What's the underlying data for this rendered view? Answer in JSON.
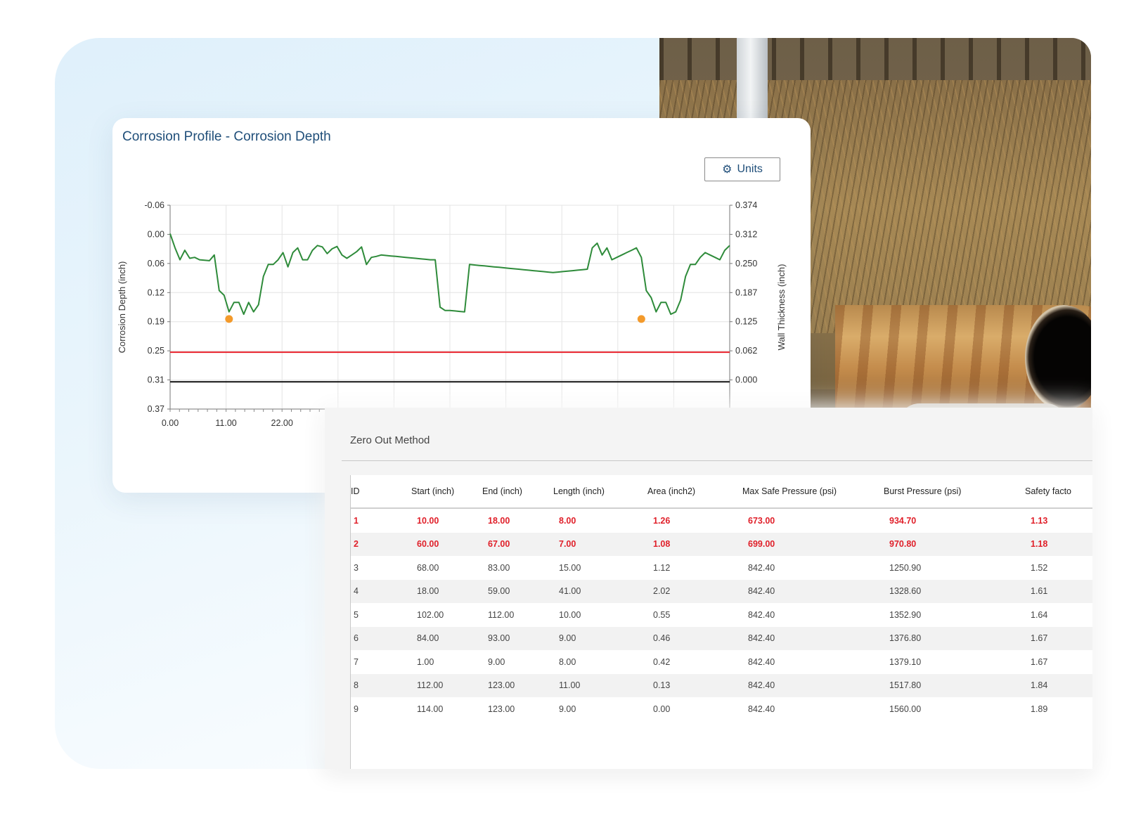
{
  "chart_card": {
    "title": "Corrosion Profile - Corrosion Depth",
    "units_button": "Units",
    "units_icon": "gear-icon"
  },
  "chart_data": {
    "type": "line",
    "title": "Corrosion Profile - Corrosion Depth",
    "ylabel_left": "Corrosion Depth (inch)",
    "ylabel_right": "Wall Thickness (inch)",
    "left_ticks": [
      "-0.06",
      "0.00",
      "0.06",
      "0.12",
      "0.19",
      "0.25",
      "0.31",
      "0.37"
    ],
    "right_ticks": [
      "0.374",
      "0.312",
      "0.250",
      "0.187",
      "0.125",
      "0.062",
      "0.000"
    ],
    "x_ticks": [
      "0.00",
      "11.00",
      "22.00"
    ],
    "ylim": [
      0.37,
      -0.06
    ],
    "xlim": [
      0,
      114
    ],
    "grid": true,
    "series": [
      {
        "color": "#2e8b3a",
        "x": [
          0,
          1,
          2,
          3,
          4,
          5,
          6,
          7,
          8,
          9,
          10,
          11,
          12,
          13,
          14,
          15,
          16,
          17,
          18,
          19,
          20,
          21,
          22,
          23,
          24,
          25,
          26,
          27,
          28,
          29,
          30,
          31,
          32,
          33,
          34,
          35,
          36,
          37,
          38,
          39,
          40,
          41,
          42,
          43,
          44,
          45,
          46,
          47,
          48,
          49,
          50,
          51,
          52,
          53,
          54,
          55,
          56,
          57,
          58,
          59,
          60,
          61,
          62,
          63,
          64,
          65,
          66,
          67,
          68,
          69,
          70,
          71,
          72,
          73,
          74,
          75,
          76,
          77,
          78,
          79,
          80,
          81,
          82,
          83,
          84,
          85,
          86,
          87,
          88,
          89,
          90,
          91,
          92,
          93,
          94,
          95,
          96,
          97,
          98,
          99,
          100,
          101,
          102,
          103,
          104,
          105,
          106,
          107,
          108,
          109,
          110,
          111,
          112,
          113,
          114
        ],
        "y": [
          0.0,
          0.03,
          0.055,
          0.035,
          0.052,
          0.05,
          0.055,
          0.056,
          0.057,
          0.045,
          0.12,
          0.13,
          0.165,
          0.145,
          0.145,
          0.17,
          0.145,
          0.165,
          0.15,
          0.09,
          0.065,
          0.065,
          0.055,
          0.04,
          0.07,
          0.04,
          0.03,
          0.055,
          0.055,
          0.035,
          0.025,
          0.028,
          0.042,
          0.032,
          0.027,
          0.045,
          0.052,
          0.045,
          0.038,
          0.028,
          0.065,
          0.05,
          0.048,
          0.045,
          0.046,
          0.047,
          0.048,
          0.049,
          0.05,
          0.051,
          0.052,
          0.053,
          0.054,
          0.055,
          0.055,
          0.155,
          0.162,
          0.162,
          0.163,
          0.164,
          0.165,
          0.065,
          0.066,
          0.067,
          0.068,
          0.069,
          0.07,
          0.071,
          0.072,
          0.073,
          0.074,
          0.075,
          0.076,
          0.077,
          0.078,
          0.079,
          0.08,
          0.081,
          0.082,
          0.081,
          0.08,
          0.079,
          0.078,
          0.077,
          0.076,
          0.075,
          0.03,
          0.02,
          0.045,
          0.03,
          0.055,
          0.05,
          0.045,
          0.04,
          0.035,
          0.03,
          0.05,
          0.12,
          0.135,
          0.165,
          0.145,
          0.145,
          0.17,
          0.165,
          0.14,
          0.09,
          0.065,
          0.065,
          0.05,
          0.04,
          0.045,
          0.05,
          0.055,
          0.035,
          0.025
        ],
        "markers": [
          {
            "x": 12,
            "y": 0.18
          },
          {
            "x": 96,
            "y": 0.18
          }
        ]
      }
    ],
    "reference_lines": [
      {
        "y": 0.25,
        "color": "#e8202a"
      },
      {
        "y": 0.3125,
        "color": "#111111"
      }
    ]
  },
  "table_panel": {
    "title": "Zero Out Method",
    "columns": [
      "ID",
      "Start (inch)",
      "End (inch)",
      "Length (inch)",
      "Area (inch2)",
      "Max Safe Pressure (psi)",
      "Burst Pressure (psi)",
      "Safety facto"
    ],
    "rows": [
      {
        "alert": true,
        "cells": [
          "1",
          "10.00",
          "18.00",
          "8.00",
          "1.26",
          "673.00",
          "934.70",
          "1.13"
        ]
      },
      {
        "alert": true,
        "cells": [
          "2",
          "60.00",
          "67.00",
          "7.00",
          "1.08",
          "699.00",
          "970.80",
          "1.18"
        ]
      },
      {
        "alert": false,
        "cells": [
          "3",
          "68.00",
          "83.00",
          "15.00",
          "1.12",
          "842.40",
          "1250.90",
          "1.52"
        ]
      },
      {
        "alert": false,
        "cells": [
          "4",
          "18.00",
          "59.00",
          "41.00",
          "2.02",
          "842.40",
          "1328.60",
          "1.61"
        ]
      },
      {
        "alert": false,
        "cells": [
          "5",
          "102.00",
          "112.00",
          "10.00",
          "0.55",
          "842.40",
          "1352.90",
          "1.64"
        ]
      },
      {
        "alert": false,
        "cells": [
          "6",
          "84.00",
          "93.00",
          "9.00",
          "0.46",
          "842.40",
          "1376.80",
          "1.67"
        ]
      },
      {
        "alert": false,
        "cells": [
          "7",
          "1.00",
          "9.00",
          "8.00",
          "0.42",
          "842.40",
          "1379.10",
          "1.67"
        ]
      },
      {
        "alert": false,
        "cells": [
          "8",
          "112.00",
          "123.00",
          "11.00",
          "0.13",
          "842.40",
          "1517.80",
          "1.84"
        ]
      },
      {
        "alert": false,
        "cells": [
          "9",
          "114.00",
          "123.00",
          "9.00",
          "0.00",
          "842.40",
          "1560.00",
          "1.89"
        ]
      }
    ]
  }
}
